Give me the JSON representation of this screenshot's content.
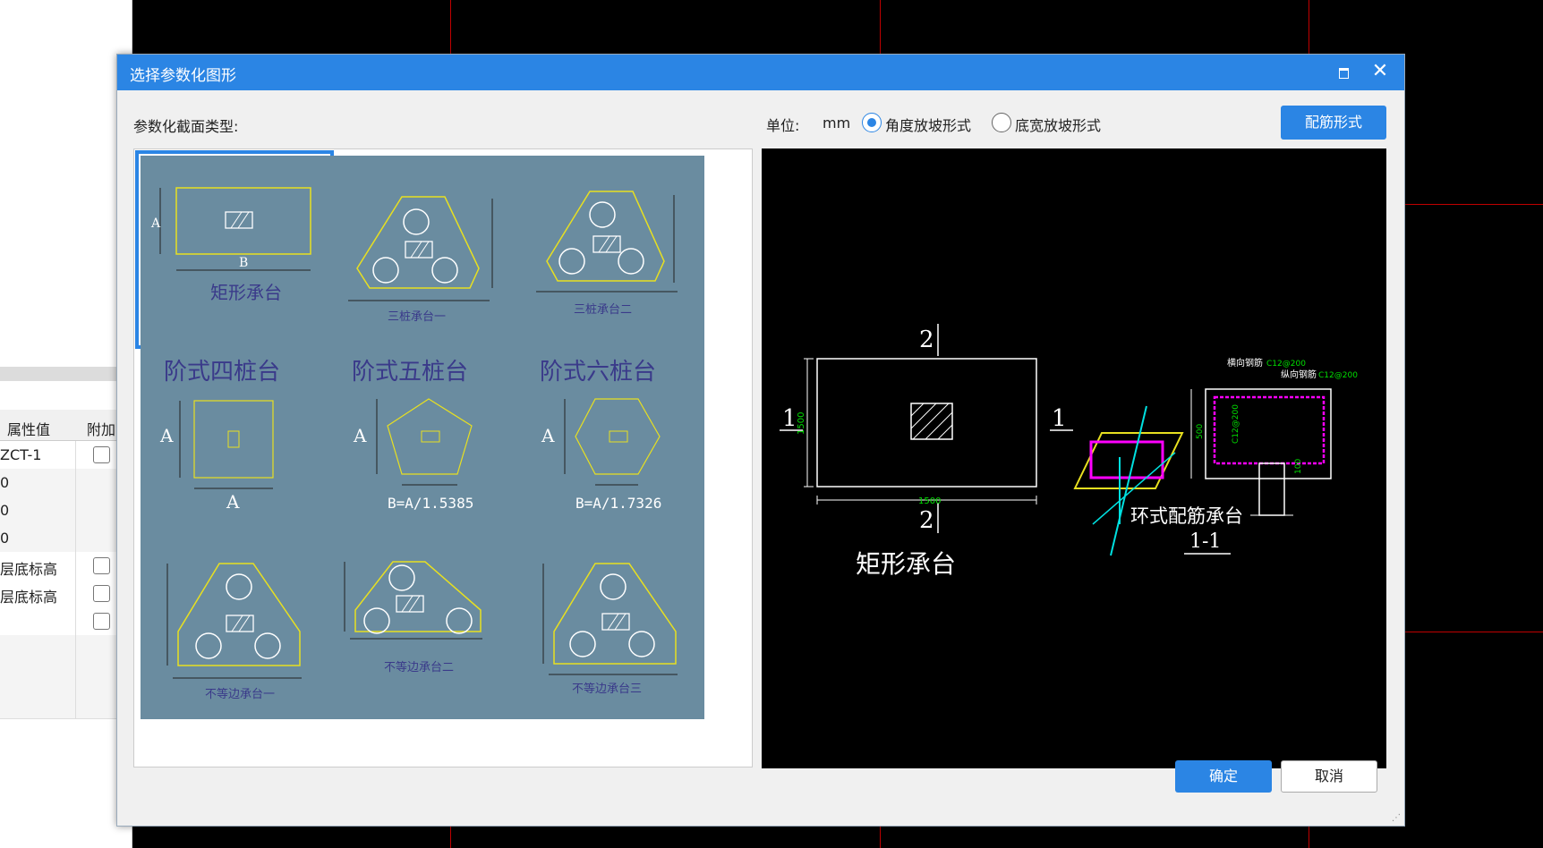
{
  "background": {
    "properties": {
      "header_value": "属性值",
      "header_extra": "附加",
      "rows": [
        {
          "value": "ZCT-1",
          "checkbox": true
        },
        {
          "value": "0",
          "checkbox": false
        },
        {
          "value": "0",
          "checkbox": false
        },
        {
          "value": "0",
          "checkbox": false
        },
        {
          "value": "层底标高",
          "checkbox": true
        },
        {
          "value": "层底标高",
          "checkbox": true
        },
        {
          "value": "",
          "checkbox": true
        },
        {
          "value": "",
          "checkbox": false
        },
        {
          "value": "",
          "checkbox": false
        },
        {
          "value": "",
          "checkbox": false
        }
      ]
    }
  },
  "dialog": {
    "title": "选择参数化图形",
    "section_label": "参数化截面类型:",
    "unit_label": "单位:",
    "unit_value": "mm",
    "radio_angle": "角度放坡形式",
    "radio_width": "底宽放坡形式",
    "radio_selected": "angle",
    "rebar_button": "配筋形式",
    "ok_button": "确定",
    "cancel_button": "取消",
    "tiles": [
      {
        "id": "rect",
        "label": "矩形承台",
        "dim_a": "A",
        "dim_b": "B",
        "selected": true
      },
      {
        "id": "tri1",
        "label": "三桩承台一",
        "selected": false
      },
      {
        "id": "tri2",
        "label": "三桩承台二",
        "selected": false
      },
      {
        "id": "step4",
        "label": "阶式四桩台",
        "dim_a": "A",
        "dim_b": "A",
        "selected": false
      },
      {
        "id": "step5",
        "label": "阶式五桩台",
        "dim_a": "A",
        "formula": "B=A/1.5385",
        "selected": false
      },
      {
        "id": "step6",
        "label": "阶式六桩台",
        "dim_a": "A",
        "formula": "B=A/1.7326",
        "selected": false
      },
      {
        "id": "uneq1",
        "label": "不等边承台一",
        "selected": false
      },
      {
        "id": "uneq2",
        "label": "不等边承台二",
        "selected": false
      },
      {
        "id": "uneq3",
        "label": "不等边承台三",
        "selected": false
      }
    ],
    "preview": {
      "plan_label": "矩形承台",
      "section_num_top": "2",
      "section_num_bottom": "2",
      "section_num_left": "1",
      "section_num_right": "1",
      "dim_height": "1500",
      "dim_width": "1500",
      "ring_label": "环式配筋承台",
      "section_label": "1-1",
      "rebar_horizontal": "横向钢筋",
      "rebar_horizontal_spec": "C12@200",
      "rebar_vertical": "纵向钢筋",
      "rebar_vertical_spec": "C12@200",
      "side_rebar_spec": "C12@200",
      "depth_500": "500",
      "depth_100": "100"
    },
    "colors": {
      "title_bar": "#2b85e4",
      "tile_bg": "#6a8ca0",
      "outline_yellow": "#e8e020",
      "dim_green": "#00e000",
      "magenta": "#ff00ff",
      "cyan": "#00e0e0"
    }
  }
}
